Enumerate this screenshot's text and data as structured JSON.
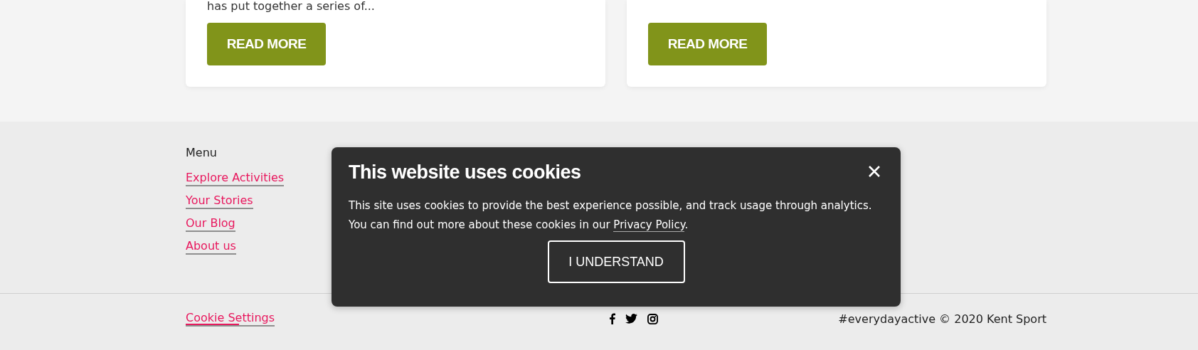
{
  "cards": [
    {
      "excerpt": "has put together a series of...",
      "button": "READ MORE"
    },
    {
      "button": "READ MORE"
    }
  ],
  "footer": {
    "menu_title": "Menu",
    "menu_links": [
      "Explore Activities",
      "Your Stories",
      "Our Blog",
      "About us"
    ],
    "cookie_settings": "Cookie Settings",
    "copyright": "#everydayactive © 2020 Kent Sport"
  },
  "cookie_dialog": {
    "title": "This website uses cookies",
    "body": "This site uses cookies to provide the best experience possible, and track usage through analytics. You can find out more about these cookies in our ",
    "link": "Privacy Policy",
    "after_link": ".",
    "button": "I UNDERSTAND"
  }
}
